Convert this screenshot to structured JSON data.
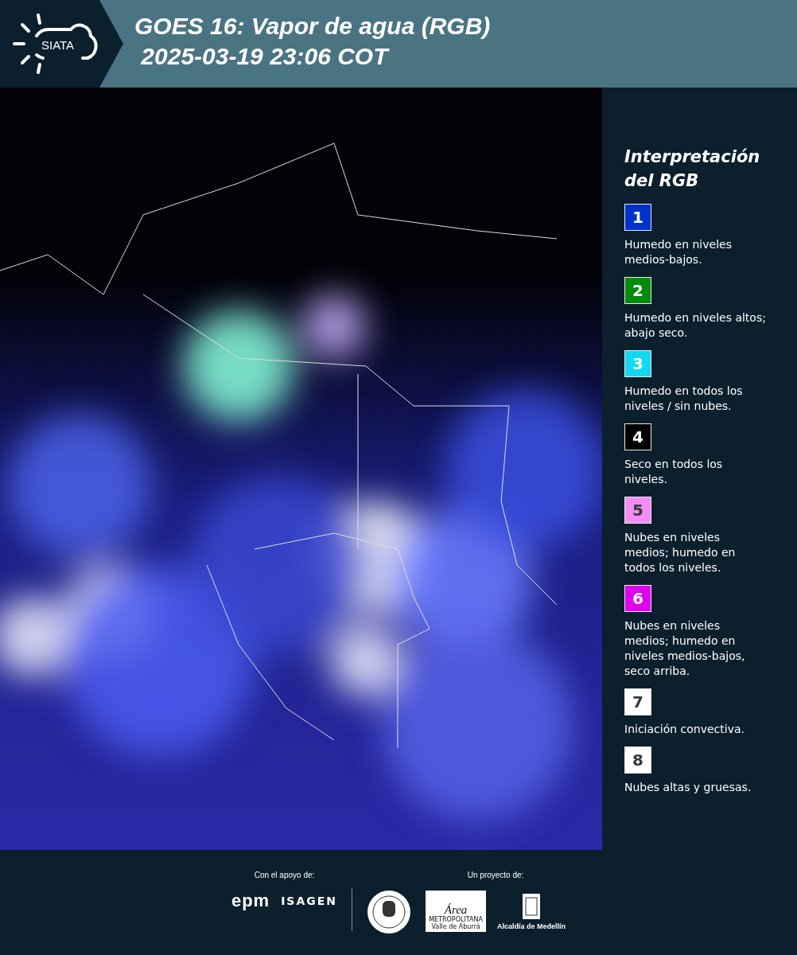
{
  "header": {
    "logo": "SIATA",
    "title": "GOES 16: Vapor de agua (RGB)",
    "timestamp": "2025-03-19 23:06 COT"
  },
  "legend": {
    "title": "Interpretación del RGB",
    "items": [
      {
        "number": "1",
        "color": "#0033cc",
        "text": "Humedo en niveles medios-bajos."
      },
      {
        "number": "2",
        "color": "#008c0a",
        "text": "Humedo en niveles altos; abajo seco."
      },
      {
        "number": "3",
        "color": "#12d8f2",
        "text": "Humedo en todos los niveles / sin nubes."
      },
      {
        "number": "4",
        "color": "#000000",
        "text": "Seco en todos los niveles."
      },
      {
        "number": "5",
        "color": "#f58cf5",
        "text": "Nubes en niveles medios; humedo en todos los niveles."
      },
      {
        "number": "6",
        "color": "#e000f0",
        "text": "Nubes en niveles medios; humedo en niveles medios-bajos, seco arriba."
      },
      {
        "number": "7",
        "color": "#ffffff",
        "text": "Iniciación convectiva."
      },
      {
        "number": "8",
        "color": "#ffffff",
        "text": "Nubes altas y gruesas."
      }
    ]
  },
  "footer": {
    "support_label": "Con el apoyo de:",
    "support_logos": [
      "epm",
      "ISAGEN"
    ],
    "project_label": "Un proyecto de:",
    "area_logo": {
      "title": "Área",
      "line_1": "METROPOLITANA",
      "line_2": "Valle de Aburrá"
    },
    "alcaldia": "Alcaldía de Medellín"
  }
}
